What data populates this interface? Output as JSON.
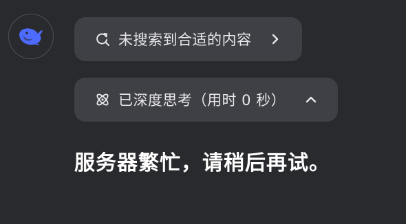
{
  "assistant": {
    "avatar_icon": "deepseek-whale-logo-icon",
    "brand_color": "#4d6bfe"
  },
  "search_status": {
    "icon": "search-refresh-icon",
    "label": "未搜索到合适的内容",
    "chevron_icon": "chevron-right-icon"
  },
  "thinking_status": {
    "icon": "atom-icon",
    "label": "已深度思考（用时 0 秒）",
    "chevron_icon": "chevron-up-icon"
  },
  "message": {
    "text": "服务器繁忙，请稍后再试。"
  },
  "colors": {
    "background": "#292a2d",
    "pill_background": "#3f4045",
    "text": "#ffffff"
  }
}
